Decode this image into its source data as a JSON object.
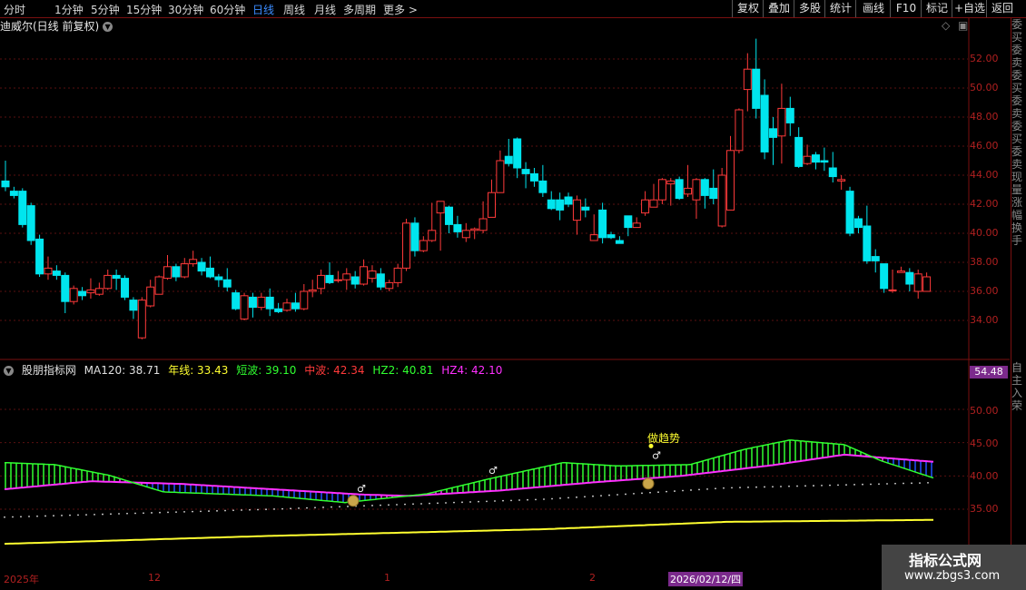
{
  "toolbar": {
    "left": [
      "分时",
      "1分钟",
      "5分钟",
      "15分钟",
      "30分钟",
      "60分钟",
      "日线",
      "周线",
      "月线",
      "多周期",
      "更多 >"
    ],
    "right": [
      "复权",
      "叠加",
      "多股",
      "统计",
      "画线",
      "F10",
      "标记",
      "+自选",
      "返回"
    ]
  },
  "main_title": "迪威尔(日线 前复权)",
  "price_axis": [
    "52.00",
    "50.00",
    "48.00",
    "46.00",
    "44.00",
    "42.00",
    "40.00",
    "38.00",
    "36.00",
    "34.00"
  ],
  "indicator": {
    "name": "股朋指标网",
    "ma120": "MA120: 38.71",
    "nianxian": "年线: 33.43",
    "duanbo": "短波: 39.10",
    "zhongbo": "中波: 42.34",
    "hz2": "HZ2: 40.81",
    "hz4": "HZ4: 42.10",
    "badge": "54.48",
    "annotation": "做趋势"
  },
  "indicator_axis": [
    "50.00",
    "45.00",
    "40.00",
    "35.00"
  ],
  "date_axis": [
    "2025年",
    "12",
    "1",
    "2"
  ],
  "date_highlight": "2026/02/12/四",
  "right_strip_top": "委买委卖委买委卖委买委卖现量涨幅换手",
  "right_strip_bottom": "自主入荣",
  "watermark": {
    "title": "指标公式网",
    "url": "www.zbgs3.com"
  },
  "colors": {
    "up": "#ff3a3a",
    "down": "#00e5ee",
    "magenta": "#ff30ff",
    "green": "#30ff30",
    "yellow": "#ffff30",
    "blue": "#2050ff"
  },
  "candles": [
    [
      43.6,
      43.2,
      45.0,
      42.9
    ],
    [
      42.9,
      42.6,
      43.2,
      42.4
    ],
    [
      42.9,
      40.6,
      43.1,
      40.4
    ],
    [
      41.9,
      39.5,
      42.1,
      39.2
    ],
    [
      39.6,
      37.2,
      39.9,
      37.0
    ],
    [
      37.2,
      37.6,
      38.4,
      36.8
    ],
    [
      37.4,
      37.1,
      37.8,
      36.8
    ],
    [
      37.1,
      35.3,
      37.3,
      34.5
    ],
    [
      35.3,
      36.2,
      36.4,
      35.1
    ],
    [
      36.0,
      35.7,
      36.3,
      35.4
    ],
    [
      35.9,
      36.1,
      36.9,
      35.5
    ],
    [
      35.8,
      36.2,
      36.6,
      35.7
    ],
    [
      36.2,
      37.1,
      37.5,
      36.1
    ],
    [
      37.1,
      36.9,
      37.5,
      36.1
    ],
    [
      36.9,
      35.6,
      37.1,
      35.4
    ],
    [
      35.4,
      34.7,
      35.6,
      34.1
    ],
    [
      32.8,
      35.4,
      35.6,
      32.7
    ],
    [
      35.0,
      36.3,
      36.8,
      34.9
    ],
    [
      35.8,
      37.0,
      37.1,
      35.8
    ],
    [
      36.9,
      37.7,
      38.5,
      36.8
    ],
    [
      37.7,
      37.0,
      37.9,
      36.7
    ],
    [
      37.0,
      37.9,
      38.3,
      36.9
    ],
    [
      37.9,
      38.2,
      38.8,
      37.7
    ],
    [
      38.0,
      37.4,
      38.3,
      37.1
    ],
    [
      37.6,
      37.0,
      38.4,
      36.9
    ],
    [
      37.0,
      36.8,
      37.2,
      36.3
    ],
    [
      36.8,
      36.3,
      37.6,
      36.0
    ],
    [
      35.9,
      34.8,
      36.1,
      34.7
    ],
    [
      34.1,
      35.7,
      35.9,
      34.0
    ],
    [
      35.6,
      34.9,
      35.9,
      34.2
    ],
    [
      34.9,
      35.6,
      35.9,
      34.7
    ],
    [
      35.6,
      34.8,
      36.2,
      34.3
    ],
    [
      34.8,
      34.6,
      35.2,
      34.5
    ],
    [
      34.7,
      35.2,
      35.5,
      34.6
    ],
    [
      35.2,
      34.8,
      35.9,
      34.6
    ],
    [
      34.8,
      36.0,
      36.5,
      34.7
    ],
    [
      36.0,
      36.1,
      36.8,
      35.6
    ],
    [
      36.2,
      37.1,
      37.5,
      35.8
    ],
    [
      37.1,
      36.6,
      38.0,
      36.5
    ],
    [
      36.8,
      36.8,
      37.4,
      36.6
    ],
    [
      36.8,
      37.2,
      37.6,
      36.1
    ],
    [
      37.0,
      36.5,
      37.4,
      36.2
    ],
    [
      36.5,
      37.7,
      38.2,
      36.4
    ],
    [
      36.9,
      37.4,
      37.8,
      36.6
    ],
    [
      37.2,
      36.3,
      37.6,
      36.1
    ],
    [
      36.2,
      36.6,
      36.8,
      36.0
    ],
    [
      36.6,
      37.6,
      37.9,
      36.3
    ],
    [
      37.6,
      40.7,
      41.0,
      37.4
    ],
    [
      40.7,
      38.8,
      41.1,
      38.4
    ],
    [
      38.8,
      39.5,
      39.8,
      38.7
    ],
    [
      39.5,
      40.2,
      42.1,
      39.4
    ],
    [
      41.4,
      42.2,
      42.2,
      38.8
    ],
    [
      41.8,
      40.6,
      41.9,
      40.0
    ],
    [
      40.6,
      40.1,
      41.2,
      39.7
    ],
    [
      39.7,
      40.2,
      40.7,
      39.4
    ],
    [
      40.2,
      40.3,
      40.4,
      39.6
    ],
    [
      40.2,
      41.0,
      42.2,
      40.0
    ],
    [
      41.1,
      42.8,
      43.7,
      41.2
    ],
    [
      42.8,
      45.0,
      45.7,
      42.9
    ],
    [
      45.3,
      44.8,
      46.5,
      44.6
    ],
    [
      46.5,
      44.5,
      46.6,
      43.8
    ],
    [
      44.4,
      44.1,
      44.9,
      43.1
    ],
    [
      44.1,
      43.6,
      44.5,
      43.2
    ],
    [
      43.6,
      42.8,
      44.7,
      42.5
    ],
    [
      42.3,
      41.7,
      42.9,
      41.6
    ],
    [
      42.3,
      41.6,
      42.8,
      40.9
    ],
    [
      42.5,
      42.0,
      42.8,
      41.8
    ],
    [
      40.9,
      42.3,
      42.6,
      39.9
    ],
    [
      41.8,
      41.6,
      42.4,
      41.1
    ],
    [
      39.5,
      39.9,
      41.3,
      39.6
    ],
    [
      41.6,
      39.7,
      42.1,
      39.3
    ],
    [
      39.9,
      39.7,
      40.1,
      39.6
    ],
    [
      39.5,
      39.3,
      39.8,
      39.5
    ],
    [
      41.2,
      40.4,
      41.2,
      39.8
    ],
    [
      40.4,
      40.7,
      41.1,
      40.4
    ],
    [
      41.4,
      42.3,
      42.9,
      41.2
    ],
    [
      41.8,
      42.3,
      43.4,
      41.8
    ],
    [
      42.3,
      43.7,
      43.8,
      42.0
    ],
    [
      43.4,
      43.6,
      43.8,
      41.9
    ],
    [
      43.7,
      42.4,
      43.9,
      42.3
    ],
    [
      42.7,
      43.1,
      44.7,
      42.5
    ],
    [
      42.3,
      43.7,
      43.8,
      41.0
    ],
    [
      43.7,
      42.6,
      43.8,
      41.7
    ],
    [
      43.1,
      42.4,
      44.4,
      42.0
    ],
    [
      40.5,
      44.0,
      44.5,
      40.4
    ],
    [
      41.6,
      45.7,
      46.7,
      41.6
    ],
    [
      45.7,
      48.5,
      48.6,
      45.5
    ],
    [
      49.9,
      51.3,
      52.4,
      48.4
    ],
    [
      51.3,
      48.6,
      53.4,
      47.9
    ],
    [
      49.5,
      45.6,
      50.6,
      45.1
    ],
    [
      47.2,
      46.6,
      48.0,
      44.7
    ],
    [
      46.7,
      48.6,
      50.3,
      44.8
    ],
    [
      48.6,
      47.6,
      49.4,
      46.7
    ],
    [
      46.6,
      44.6,
      47.3,
      44.5
    ],
    [
      44.8,
      45.3,
      46.1,
      44.7
    ],
    [
      45.4,
      44.9,
      45.6,
      44.4
    ],
    [
      45.0,
      44.9,
      45.9,
      44.3
    ],
    [
      44.5,
      43.9,
      45.6,
      43.5
    ],
    [
      43.6,
      43.7,
      44.0,
      43.0
    ],
    [
      42.9,
      40.0,
      43.2,
      39.8
    ],
    [
      41.0,
      40.4,
      41.2,
      40.0
    ],
    [
      40.5,
      38.1,
      41.9,
      37.9
    ],
    [
      38.4,
      38.1,
      38.9,
      37.3
    ],
    [
      37.9,
      36.2,
      37.9,
      35.9
    ],
    [
      36.1,
      36.1,
      37.5,
      35.9
    ],
    [
      37.3,
      37.4,
      37.7,
      37.3
    ],
    [
      37.3,
      36.5,
      37.6,
      36.0
    ],
    [
      36.0,
      37.2,
      37.5,
      35.5
    ],
    [
      36.0,
      37.0,
      37.3,
      36.3
    ]
  ]
}
